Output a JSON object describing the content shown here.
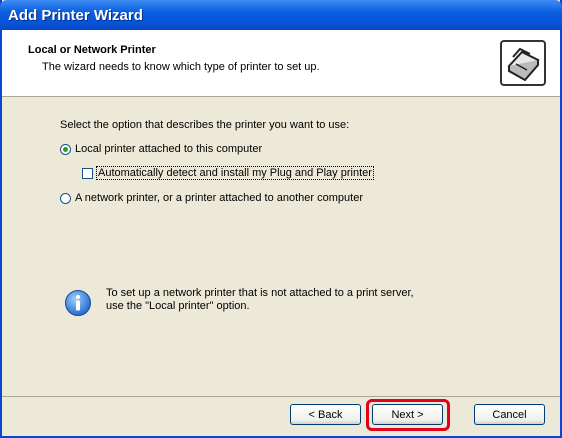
{
  "window": {
    "title": "Add Printer Wizard"
  },
  "header": {
    "title": "Local or Network Printer",
    "subtitle": "The wizard needs to know which type of printer to set up."
  },
  "content": {
    "prompt": "Select the option that describes the printer you want to use:",
    "options": [
      {
        "label": "Local printer attached to this computer",
        "selected": true
      },
      {
        "label": "A network printer, or a printer attached to another computer",
        "selected": false
      }
    ],
    "auto_detect_label": "Automatically detect and install my Plug and Play printer",
    "auto_detect_checked": false,
    "info_line1": "To set up a network printer that is not attached to a print server,",
    "info_line2": "use the \"Local printer\" option."
  },
  "buttons": {
    "back": "< Back",
    "next": "Next >",
    "cancel": "Cancel"
  },
  "colors": {
    "highlight": "#e2001a",
    "titlebar": "#0553d6",
    "radio_dot": "#21a121"
  }
}
